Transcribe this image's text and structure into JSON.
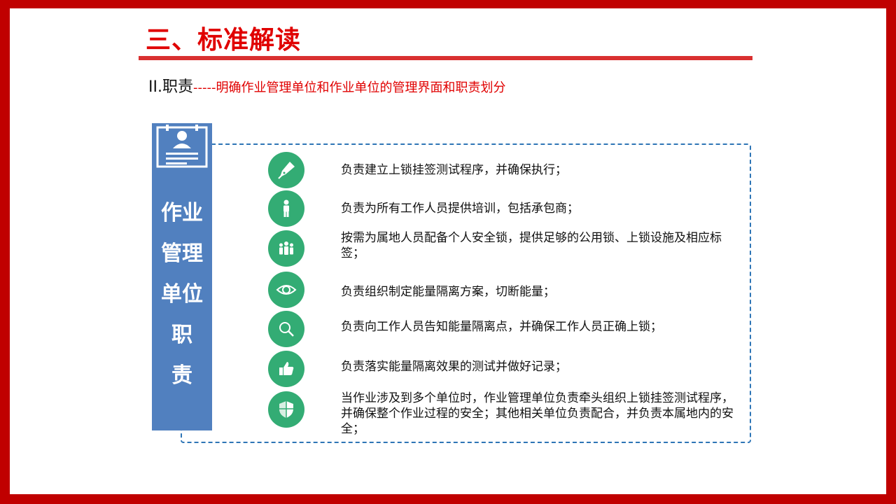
{
  "title": "三、标准解读",
  "subtitle": {
    "main": "II.职责",
    "dash": "-----",
    "desc": "明确作业管理单位和作业单位的管理界面和职责划分"
  },
  "side_panel": {
    "lines": [
      "作业",
      "管理",
      "单位",
      "职",
      "责"
    ]
  },
  "items": [
    {
      "icon": "pen-nib-icon",
      "text": "负责建立上锁挂签测试程序，并确保执行；"
    },
    {
      "icon": "person-icon",
      "text": "负责为所有工作人员提供培训，包括承包商；"
    },
    {
      "icon": "group-icon",
      "text": "按需为属地人员配备个人安全锁，提供足够的公用锁、上锁设施及相应标签；"
    },
    {
      "icon": "eye-icon",
      "text": "负责组织制定能量隔离方案，切断能量；"
    },
    {
      "icon": "magnifier-icon",
      "text": "负责向工作人员告知能量隔离点，并确保工作人员正确上锁；"
    },
    {
      "icon": "thumbs-up-icon",
      "text": "负责落实能量隔离效果的测试并做好记录；"
    },
    {
      "icon": "shield-icon",
      "text": "当作业涉及到多个单位时，作业管理单位负责牵头组织上锁挂签测试程序，并确保整个作业过程的安全；其他相关单位负责配合，并负责本属地内的安全；"
    }
  ],
  "colors": {
    "frame": "#c00000",
    "title": "#e00000",
    "panel": "#5180bf",
    "icon_bg": "#33ac74",
    "dashed_border": "#2e75b6"
  }
}
